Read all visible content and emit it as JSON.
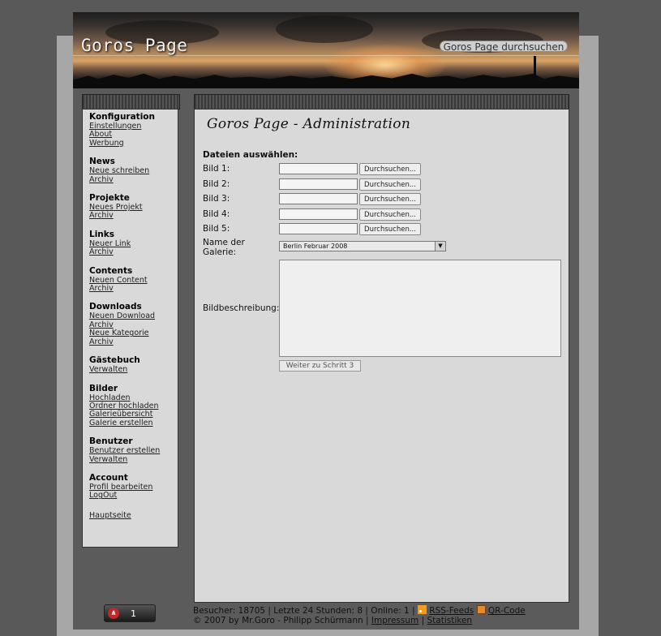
{
  "header": {
    "site_title": "Goros Page",
    "search_button": "Goros Page durchsuchen"
  },
  "sidebar": {
    "groups": [
      {
        "title": "Konfiguration",
        "links": [
          "Einstellungen",
          "About",
          "Werbung"
        ]
      },
      {
        "title": "News",
        "links": [
          "Neue schreiben",
          "Archiv"
        ]
      },
      {
        "title": "Projekte",
        "links": [
          "Neues Projekt",
          "Archiv"
        ]
      },
      {
        "title": "Links",
        "links": [
          "Neuer Link",
          "Archiv"
        ]
      },
      {
        "title": "Contents",
        "links": [
          "Neuen Content",
          "Archiv"
        ]
      },
      {
        "title": "Downloads",
        "links": [
          "Neuen Download",
          "Archiv",
          "Neue Kategorie",
          "Archiv"
        ]
      },
      {
        "title": "Gästebuch",
        "links": [
          "Verwalten"
        ]
      },
      {
        "title": "Bilder",
        "links": [
          "Hochladen",
          "Ordner hochladen",
          "Galerieübersicht",
          "Galerie erstellen"
        ]
      },
      {
        "title": "Benutzer",
        "links": [
          "Benutzer erstellen",
          "Verwalten"
        ]
      },
      {
        "title": "Account",
        "links": [
          "Profil bearbeiten",
          "LogOut"
        ]
      }
    ],
    "home_link": "Hauptseite"
  },
  "main": {
    "title": "Goros Page - Administration",
    "form_heading": "Dateien auswählen:",
    "files": [
      {
        "label": "Bild 1:",
        "value": "",
        "button": "Durchsuchen..."
      },
      {
        "label": "Bild 2:",
        "value": "",
        "button": "Durchsuchen..."
      },
      {
        "label": "Bild 3:",
        "value": "",
        "button": "Durchsuchen..."
      },
      {
        "label": "Bild 4:",
        "value": "",
        "button": "Durchsuchen..."
      },
      {
        "label": "Bild 5:",
        "value": "",
        "button": "Durchsuchen..."
      }
    ],
    "gallery_label_line1": "Name der",
    "gallery_label_line2": "Galerie:",
    "gallery_selected": "Berlin Februar 2008",
    "description_label": "Bildbeschreibung:",
    "description_value": "",
    "next_button": "Weiter zu Schritt 3"
  },
  "counter": {
    "value": "1"
  },
  "footer": {
    "line1_prefix": "Besucher: 18705 | Letzte 24 Stunden: 8 | Online: 1 |",
    "rss_link": "RSS-Feeds",
    "qr_link": "QR-Code",
    "copyright": "© 2007 by Mr.Goro - Philipp Schürmann |",
    "impressum_link": "Impressum",
    "sep": "|",
    "statistiken_link": "Statistiken"
  }
}
